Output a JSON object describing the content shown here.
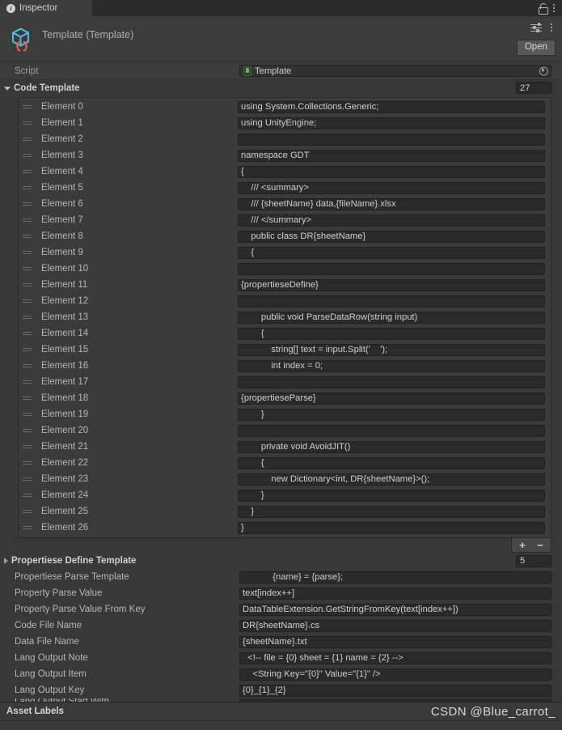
{
  "window": {
    "tab_label": "Inspector",
    "tab_icon": "info-icon",
    "lock_icon": "lock-icon",
    "menu_icon": "kebab-menu-icon"
  },
  "header": {
    "title": "Template (Template)",
    "asset_icon": "scriptable-object-cube-icon",
    "preset_icon": "preset-settings-icon",
    "menu_icon": "kebab-menu-icon",
    "open_label": "Open"
  },
  "script_row": {
    "label": "Script",
    "value": "Template",
    "script_icon": "csharp-script-icon",
    "picker_icon": "object-picker-icon"
  },
  "code_template": {
    "label": "Code Template",
    "count": "27",
    "add_label": "+",
    "remove_label": "−",
    "elements": [
      {
        "name": "Element 0",
        "value": "using System.Collections.Generic;"
      },
      {
        "name": "Element 1",
        "value": "using UnityEngine;"
      },
      {
        "name": "Element 2",
        "value": ""
      },
      {
        "name": "Element 3",
        "value": "namespace GDT"
      },
      {
        "name": "Element 4",
        "value": "{"
      },
      {
        "name": "Element 5",
        "value": "    /// <summary>"
      },
      {
        "name": "Element 6",
        "value": "    /// {sheetName} data,{fileName}.xlsx"
      },
      {
        "name": "Element 7",
        "value": "    /// </summary>"
      },
      {
        "name": "Element 8",
        "value": "    public class DR{sheetName}"
      },
      {
        "name": "Element 9",
        "value": "    {"
      },
      {
        "name": "Element 10",
        "value": ""
      },
      {
        "name": "Element 11",
        "value": "{propertieseDefine}"
      },
      {
        "name": "Element 12",
        "value": ""
      },
      {
        "name": "Element 13",
        "value": "        public void ParseDataRow(string input)"
      },
      {
        "name": "Element 14",
        "value": "        {"
      },
      {
        "name": "Element 15",
        "value": "            string[] text = input.Split('    ');"
      },
      {
        "name": "Element 16",
        "value": "            int index = 0;"
      },
      {
        "name": "Element 17",
        "value": ""
      },
      {
        "name": "Element 18",
        "value": "{propertieseParse}"
      },
      {
        "name": "Element 19",
        "value": "        }"
      },
      {
        "name": "Element 20",
        "value": ""
      },
      {
        "name": "Element 21",
        "value": "        private void AvoidJIT()"
      },
      {
        "name": "Element 22",
        "value": "        {"
      },
      {
        "name": "Element 23",
        "value": "            new Dictionary<int, DR{sheetName}>();"
      },
      {
        "name": "Element 24",
        "value": "        }"
      },
      {
        "name": "Element 25",
        "value": "    }"
      },
      {
        "name": "Element 26",
        "value": "}"
      }
    ]
  },
  "propertiese_define": {
    "label": "Propertiese Define Template",
    "count": "5"
  },
  "properties": [
    {
      "label": "Propertiese Parse Template",
      "value": "            {name} = {parse};"
    },
    {
      "label": "Property Parse Value",
      "value": "text[index++]"
    },
    {
      "label": "Property Parse Value From Key",
      "value": "DataTableExtension.GetStringFromKey(text[index++])"
    },
    {
      "label": "Code File Name",
      "value": "DR{sheetName}.cs"
    },
    {
      "label": "Data File Name",
      "value": "{sheetName}.txt"
    },
    {
      "label": "Lang Output Note",
      "value": "  <!-- file = {0} sheet = {1} name = {2} -->"
    },
    {
      "label": "Lang Output Item",
      "value": "    <String Key=\"{0}\" Value=\"{1}\" />"
    },
    {
      "label": "Lang Output Key",
      "value": "{0}_{1}_{2}"
    }
  ],
  "clipped_row": {
    "label": "Lang Output Start With"
  },
  "footer": {
    "asset_labels": "Asset Labels",
    "watermark": "CSDN @Blue_carrot_"
  },
  "colors": {
    "background": "#383838",
    "header": "#3c3c3c",
    "field": "#2a2a2a",
    "accent_cube": "#4ec3e8",
    "accent_braces": "#e8603c"
  }
}
